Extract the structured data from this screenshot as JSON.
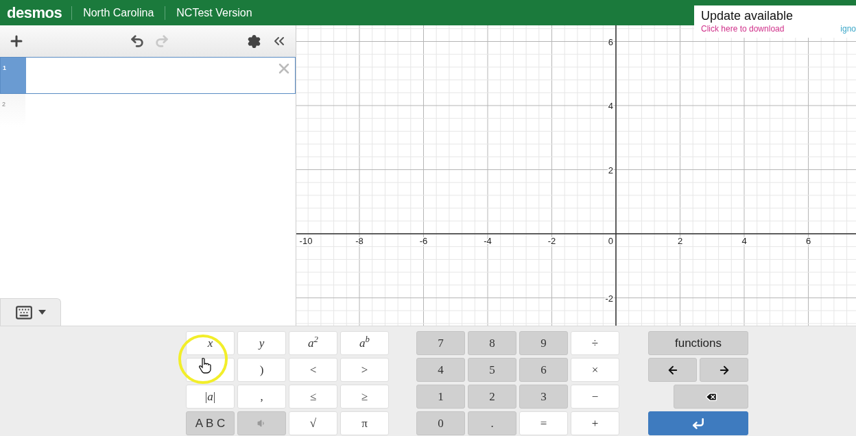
{
  "header": {
    "logo": "desmos",
    "items": [
      "North Carolina",
      "NCTest Version"
    ]
  },
  "update_popup": {
    "title": "Update available",
    "link": "Click here to download",
    "action": "igno"
  },
  "toolbar": {
    "undo_disabled": false,
    "redo_disabled": true
  },
  "keyboard_toggle": {
    "expanded": true
  },
  "expressions": [
    {
      "index": "1",
      "selected": true
    },
    {
      "index": "2",
      "selected": false
    }
  ],
  "graph": {
    "x_labels": [
      "-10",
      "-8",
      "-6",
      "-4",
      "-2",
      "0",
      "2",
      "4",
      "6"
    ],
    "y_labels": [
      "6",
      "4",
      "2",
      "-2"
    ]
  },
  "keypad": {
    "left_keys": [
      {
        "kind": "variable",
        "label": "x",
        "dark": false
      },
      {
        "kind": "variable",
        "label": "y",
        "dark": false
      },
      {
        "kind": "variable",
        "label": "a$^{2}$",
        "dark": false
      },
      {
        "kind": "variable",
        "label": "a$^{b}$",
        "dark": false
      },
      {
        "kind": "blank",
        "dark": false
      },
      {
        "kind": "text",
        "label": ")",
        "dark": false
      },
      {
        "kind": "text",
        "label": "<",
        "dark": false
      },
      {
        "kind": "text",
        "label": ">",
        "dark": false
      },
      {
        "kind": "text",
        "label": "|*a*|",
        "dark": false
      },
      {
        "kind": "text",
        "label": ",",
        "dark": false
      },
      {
        "kind": "text",
        "label": "≤",
        "dark": false
      },
      {
        "kind": "text",
        "label": "≥",
        "dark": false
      },
      {
        "kind": "sans",
        "label": "A B C",
        "dark": true
      },
      {
        "kind": "speaker",
        "dark": true
      },
      {
        "kind": "text",
        "label": "√",
        "dark": false
      },
      {
        "kind": "text",
        "label": "π",
        "dark": false
      }
    ],
    "number_keys": [
      {
        "label": "7",
        "dark": true
      },
      {
        "label": "8",
        "dark": true
      },
      {
        "label": "9",
        "dark": true
      },
      {
        "label": "÷",
        "dark": false
      },
      {
        "label": "4",
        "dark": true
      },
      {
        "label": "5",
        "dark": true
      },
      {
        "label": "6",
        "dark": true
      },
      {
        "label": "×",
        "dark": false
      },
      {
        "label": "1",
        "dark": true
      },
      {
        "label": "2",
        "dark": true
      },
      {
        "label": "3",
        "dark": true
      },
      {
        "label": "−",
        "dark": false
      },
      {
        "label": "0",
        "dark": true
      },
      {
        "label": ".",
        "dark": true
      },
      {
        "label": "=",
        "dark": false
      },
      {
        "label": "+",
        "dark": false
      }
    ],
    "side_keys": [
      {
        "kind": "text",
        "label": "functions"
      },
      {
        "kind": "left"
      },
      {
        "kind": "right"
      },
      {
        "kind": "backspace"
      },
      {
        "kind": "enter"
      }
    ]
  }
}
